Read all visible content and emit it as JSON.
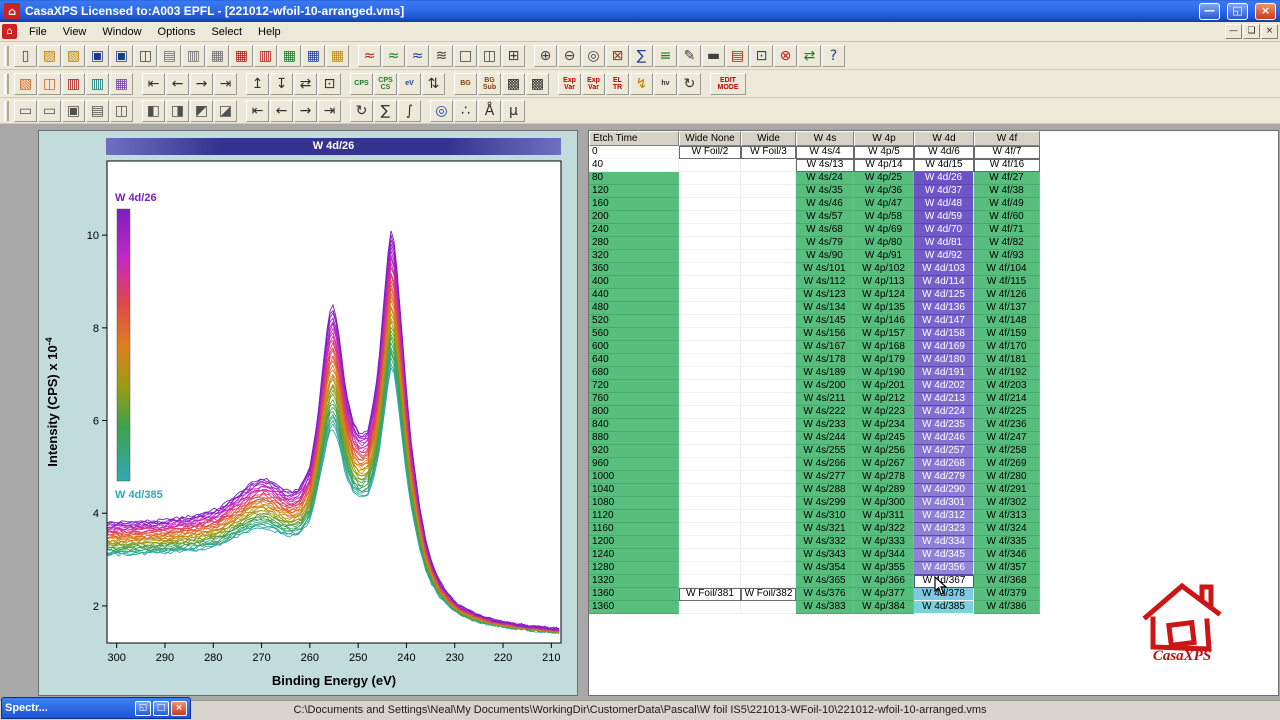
{
  "title_bar": {
    "title": "CasaXPS Licensed to:A003 EPFL - [221012-wfoil-10-arranged.vms]",
    "minimize": "—",
    "restore": "◱",
    "close": "×"
  },
  "menu": {
    "items": [
      "File",
      "View",
      "Window",
      "Options",
      "Select",
      "Help"
    ]
  },
  "toolbars": {
    "row1": [
      {
        "name": "new-file",
        "g": "▯",
        "c": "#404040"
      },
      {
        "name": "open-folder",
        "g": "▨",
        "c": "#C08A00"
      },
      {
        "name": "convert-folder",
        "g": "▧",
        "c": "#C08A00"
      },
      {
        "name": "save",
        "g": "▣",
        "c": "#163E8C"
      },
      {
        "name": "save-as",
        "g": "▣",
        "c": "#163E8C"
      },
      {
        "name": "copy-page",
        "g": "◫",
        "c": "#404040"
      },
      {
        "name": "page-single",
        "g": "▤",
        "c": "#707070"
      },
      {
        "name": "page-double",
        "g": "▥",
        "c": "#707070"
      },
      {
        "name": "page-grid",
        "g": "▦",
        "c": "#707070"
      },
      {
        "name": "block-red",
        "g": "▦",
        "c": "#B02020"
      },
      {
        "name": "block-red-2",
        "g": "▥",
        "c": "#B02020"
      },
      {
        "name": "block-green",
        "g": "▦",
        "c": "#207830"
      },
      {
        "name": "block-blue",
        "g": "▦",
        "c": "#203FA0"
      },
      {
        "name": "block-yellow",
        "g": "▦",
        "c": "#B89010"
      },
      {
        "sep": true
      },
      {
        "name": "spectrum-red",
        "g": "≈",
        "c": "#B02020"
      },
      {
        "name": "spectrum-green",
        "g": "≈",
        "c": "#207830"
      },
      {
        "name": "spectrum-blue",
        "g": "≈",
        "c": "#203FA0"
      },
      {
        "name": "overlay-spectra",
        "g": "≋",
        "c": "#404040"
      },
      {
        "name": "tile-one",
        "g": "□",
        "c": "#404040"
      },
      {
        "name": "tile-two",
        "g": "◫",
        "c": "#404040"
      },
      {
        "name": "tile-four",
        "g": "⊞",
        "c": "#404040"
      },
      {
        "sep": true
      },
      {
        "name": "zoom-in",
        "g": "⊕",
        "c": "#404040"
      },
      {
        "name": "zoom-out",
        "g": "⊖",
        "c": "#404040"
      },
      {
        "name": "zoom-reset",
        "g": "◎",
        "c": "#404040"
      },
      {
        "name": "processing",
        "g": "⊠",
        "c": "#8B4020"
      },
      {
        "name": "quantify",
        "g": "∑",
        "c": "#203FA0"
      },
      {
        "name": "element-library",
        "g": "≡",
        "c": "#207830"
      },
      {
        "name": "annotate",
        "g": "✎",
        "c": "#404040"
      },
      {
        "name": "print",
        "g": "▬",
        "c": "#404040"
      },
      {
        "name": "report",
        "g": "▤",
        "c": "#B02020"
      },
      {
        "name": "calculator",
        "g": "⊡",
        "c": "#203FA0"
      },
      {
        "name": "delete-block",
        "g": "⊗",
        "c": "#B02020"
      },
      {
        "name": "link-blocks",
        "g": "⇄",
        "c": "#207830"
      },
      {
        "name": "help",
        "g": "?",
        "c": "#203FA0"
      }
    ],
    "row2": [
      {
        "name": "orange-block",
        "g": "▧",
        "c": "#D2691E"
      },
      {
        "name": "cascade-pages",
        "g": "◫",
        "c": "#D2691E"
      },
      {
        "name": "red-book",
        "g": "▥",
        "c": "#B02020"
      },
      {
        "name": "teal-book",
        "g": "▥",
        "c": "#107878"
      },
      {
        "name": "purple-block",
        "g": "▦",
        "c": "#7040A0"
      },
      {
        "sep": true
      },
      {
        "name": "nav-first",
        "g": "⇤",
        "c": "#303030"
      },
      {
        "name": "nav-prev",
        "g": "←",
        "c": "#303030"
      },
      {
        "name": "nav-next",
        "g": "→",
        "c": "#303030"
      },
      {
        "name": "nav-last",
        "g": "⇥",
        "c": "#303030"
      },
      {
        "sep": true
      },
      {
        "name": "move-up",
        "g": "↥",
        "c": "#303030"
      },
      {
        "name": "move-down",
        "g": "↧",
        "c": "#303030"
      },
      {
        "name": "swap-blocks",
        "g": "⇄",
        "c": "#303030"
      },
      {
        "name": "zoom-region",
        "g": "⊡",
        "c": "#303030"
      },
      {
        "sep": true
      },
      {
        "name": "cps-scale",
        "txt": [
          "CPS"
        ],
        "c": "#207830"
      },
      {
        "name": "cps-cs-scale",
        "txt": [
          "CPS",
          "CS"
        ],
        "c": "#207830"
      },
      {
        "name": "ev-scale",
        "txt": [
          "eV"
        ],
        "c": "#203FA0"
      },
      {
        "name": "step-scale",
        "g": "⇅",
        "c": "#303030"
      },
      {
        "sep": true
      },
      {
        "name": "background",
        "txt": [
          "BG"
        ],
        "c": "#804010"
      },
      {
        "name": "background-subtract",
        "txt": [
          "BG",
          "Sub"
        ],
        "c": "#804010"
      },
      {
        "name": "component-fit",
        "g": "▩",
        "c": "#303030"
      },
      {
        "name": "component-fit-2",
        "g": "▩",
        "c": "#303030"
      },
      {
        "sep": true
      },
      {
        "name": "exp-var",
        "txt": [
          "Exp",
          "Var"
        ],
        "c": "#C00000"
      },
      {
        "name": "exp-var-2",
        "txt": [
          "Exp",
          "Var"
        ],
        "c": "#C00000"
      },
      {
        "name": "el-tr",
        "txt": [
          "EL",
          "TR"
        ],
        "c": "#C00000"
      },
      {
        "name": "lightning",
        "g": "↯",
        "c": "#C08000"
      },
      {
        "name": "hv-label",
        "txt": [
          "hv"
        ],
        "c": "#303030"
      },
      {
        "name": "refresh",
        "g": "↻",
        "c": "#303030"
      },
      {
        "sep": true
      },
      {
        "name": "edit-mode",
        "txt": [
          "EDIT",
          "MODE"
        ],
        "c": "#C00000",
        "wide": true
      }
    ],
    "row3": [
      {
        "name": "view-1",
        "g": "▭",
        "c": "#505050"
      },
      {
        "name": "view-2",
        "g": "▭",
        "c": "#505050"
      },
      {
        "name": "view-3",
        "g": "▣",
        "c": "#505050"
      },
      {
        "name": "view-4",
        "g": "▤",
        "c": "#505050"
      },
      {
        "name": "view-5",
        "g": "◫",
        "c": "#505050"
      },
      {
        "sep": true
      },
      {
        "name": "split-left",
        "g": "◧",
        "c": "#505050"
      },
      {
        "name": "split-right",
        "g": "◨",
        "c": "#505050"
      },
      {
        "name": "split-top",
        "g": "◩",
        "c": "#505050"
      },
      {
        "name": "split-bottom",
        "g": "◪",
        "c": "#505050"
      },
      {
        "sep": true
      },
      {
        "name": "page-first",
        "g": "⇤",
        "c": "#303030"
      },
      {
        "name": "page-prev",
        "g": "←",
        "c": "#303030"
      },
      {
        "name": "page-next",
        "g": "→",
        "c": "#303030"
      },
      {
        "name": "page-last",
        "g": "⇥",
        "c": "#303030"
      },
      {
        "sep": true
      },
      {
        "name": "rotate-view",
        "g": "↻",
        "c": "#303030"
      },
      {
        "name": "sum-spectra",
        "g": "∑",
        "c": "#303030"
      },
      {
        "name": "integrate",
        "g": "∫",
        "c": "#303030"
      },
      {
        "sep": true
      },
      {
        "name": "find",
        "g": "◎",
        "c": "#203FA0"
      },
      {
        "name": "markers",
        "g": "∴",
        "c": "#303030"
      },
      {
        "name": "angstrom",
        "g": "Å",
        "c": "#303030"
      },
      {
        "name": "micro",
        "g": "µ",
        "c": "#303030"
      }
    ]
  },
  "chart": {
    "header": "W 4d/26"
  },
  "chart_data": {
    "type": "line",
    "title": "W 4d/26",
    "xlabel": "Binding Energy (eV)",
    "ylabel_main": "Intensity (CPS) x 10",
    "ylabel_sup": "-4",
    "x_axis_reversed": true,
    "x_range": [
      302,
      208
    ],
    "y_range": [
      1.2,
      11.6
    ],
    "x_ticks": [
      300,
      290,
      280,
      270,
      260,
      250,
      240,
      230,
      220,
      210
    ],
    "y_ticks": [
      2,
      4,
      6,
      8,
      10
    ],
    "n_curves": 34,
    "first_label": "W 4d/26",
    "last_label": "W 4d/385",
    "x": [
      302,
      296,
      290,
      284,
      279,
      275,
      272,
      270,
      268,
      266,
      264,
      262,
      260,
      258.5,
      257.5,
      256.5,
      255.8,
      255,
      254,
      252.5,
      251,
      249.5,
      248,
      246.5,
      245.5,
      244.5,
      243.8,
      243.2,
      242.6,
      242,
      241.2,
      240.2,
      239,
      237.5,
      236,
      234.5,
      233,
      231,
      229,
      226,
      222,
      218,
      214,
      210,
      208
    ],
    "envelope_top": [
      3.8,
      3.82,
      3.85,
      3.95,
      4.1,
      4.4,
      4.65,
      4.75,
      4.7,
      4.55,
      4.45,
      4.55,
      5.0,
      5.95,
      6.95,
      7.95,
      8.35,
      8.5,
      7.9,
      6.6,
      5.95,
      5.7,
      5.8,
      6.55,
      7.5,
      8.8,
      9.6,
      10.1,
      9.9,
      9.3,
      8.3,
      6.9,
      5.5,
      4.3,
      3.4,
      2.85,
      2.5,
      2.2,
      2.0,
      1.85,
      1.7,
      1.62,
      1.56,
      1.52,
      1.5
    ],
    "envelope_bottom": [
      3.1,
      3.12,
      3.15,
      3.2,
      3.3,
      3.5,
      3.65,
      3.7,
      3.65,
      3.55,
      3.5,
      3.55,
      3.85,
      4.45,
      5.0,
      5.5,
      5.75,
      5.85,
      5.5,
      4.8,
      4.45,
      4.3,
      4.4,
      4.85,
      5.4,
      6.2,
      6.8,
      7.15,
      7.0,
      6.6,
      5.9,
      5.0,
      4.1,
      3.35,
      2.75,
      2.42,
      2.18,
      1.98,
      1.82,
      1.68,
      1.58,
      1.52,
      1.47,
      1.44,
      1.42
    ],
    "colormap": [
      [
        0,
        "#7A1FC0"
      ],
      [
        0.18,
        "#C428C4"
      ],
      [
        0.35,
        "#E0484A"
      ],
      [
        0.5,
        "#DE7F1E"
      ],
      [
        0.65,
        "#9C9C14"
      ],
      [
        0.8,
        "#3FA04B"
      ],
      [
        1,
        "#2FAAB4"
      ]
    ]
  },
  "table": {
    "headers": [
      "Etch Time",
      "Wide None",
      "Wide",
      "W 4s",
      "W 4p",
      "W 4d",
      "W 4f"
    ],
    "rows": [
      [
        "0",
        "W Foil/2",
        "W Foil/3",
        "W 4s/4",
        "W 4p/5",
        "W 4d/6",
        "W 4f/7"
      ],
      [
        "40",
        "",
        "",
        "W 4s/13",
        "W 4p/14",
        "W 4d/15",
        "W 4f/16"
      ],
      [
        "80",
        "",
        "",
        "W 4s/24",
        "W 4p/25",
        "W 4d/26",
        "W 4f/27"
      ],
      [
        "120",
        "",
        "",
        "W 4s/35",
        "W 4p/36",
        "W 4d/37",
        "W 4f/38"
      ],
      [
        "160",
        "",
        "",
        "W 4s/46",
        "W 4p/47",
        "W 4d/48",
        "W 4f/49"
      ],
      [
        "200",
        "",
        "",
        "W 4s/57",
        "W 4p/58",
        "W 4d/59",
        "W 4f/60"
      ],
      [
        "240",
        "",
        "",
        "W 4s/68",
        "W 4p/69",
        "W 4d/70",
        "W 4f/71"
      ],
      [
        "280",
        "",
        "",
        "W 4s/79",
        "W 4p/80",
        "W 4d/81",
        "W 4f/82"
      ],
      [
        "320",
        "",
        "",
        "W 4s/90",
        "W 4p/91",
        "W 4d/92",
        "W 4f/93"
      ],
      [
        "360",
        "",
        "",
        "W 4s/101",
        "W 4p/102",
        "W 4d/103",
        "W 4f/104"
      ],
      [
        "400",
        "",
        "",
        "W 4s/112",
        "W 4p/113",
        "W 4d/114",
        "W 4f/115"
      ],
      [
        "440",
        "",
        "",
        "W 4s/123",
        "W 4p/124",
        "W 4d/125",
        "W 4f/126"
      ],
      [
        "480",
        "",
        "",
        "W 4s/134",
        "W 4p/135",
        "W 4d/136",
        "W 4f/137"
      ],
      [
        "520",
        "",
        "",
        "W 4s/145",
        "W 4p/146",
        "W 4d/147",
        "W 4f/148"
      ],
      [
        "560",
        "",
        "",
        "W 4s/156",
        "W 4p/157",
        "W 4d/158",
        "W 4f/159"
      ],
      [
        "600",
        "",
        "",
        "W 4s/167",
        "W 4p/168",
        "W 4d/169",
        "W 4f/170"
      ],
      [
        "640",
        "",
        "",
        "W 4s/178",
        "W 4p/179",
        "W 4d/180",
        "W 4f/181"
      ],
      [
        "680",
        "",
        "",
        "W 4s/189",
        "W 4p/190",
        "W 4d/191",
        "W 4f/192"
      ],
      [
        "720",
        "",
        "",
        "W 4s/200",
        "W 4p/201",
        "W 4d/202",
        "W 4f/203"
      ],
      [
        "760",
        "",
        "",
        "W 4s/211",
        "W 4p/212",
        "W 4d/213",
        "W 4f/214"
      ],
      [
        "800",
        "",
        "",
        "W 4s/222",
        "W 4p/223",
        "W 4d/224",
        "W 4f/225"
      ],
      [
        "840",
        "",
        "",
        "W 4s/233",
        "W 4p/234",
        "W 4d/235",
        "W 4f/236"
      ],
      [
        "880",
        "",
        "",
        "W 4s/244",
        "W 4p/245",
        "W 4d/246",
        "W 4f/247"
      ],
      [
        "920",
        "",
        "",
        "W 4s/255",
        "W 4p/256",
        "W 4d/257",
        "W 4f/258"
      ],
      [
        "960",
        "",
        "",
        "W 4s/266",
        "W 4p/267",
        "W 4d/268",
        "W 4f/269"
      ],
      [
        "1000",
        "",
        "",
        "W 4s/277",
        "W 4p/278",
        "W 4d/279",
        "W 4f/280"
      ],
      [
        "1040",
        "",
        "",
        "W 4s/288",
        "W 4p/289",
        "W 4d/290",
        "W 4f/291"
      ],
      [
        "1080",
        "",
        "",
        "W 4s/299",
        "W 4p/300",
        "W 4d/301",
        "W 4f/302"
      ],
      [
        "1120",
        "",
        "",
        "W 4s/310",
        "W 4p/311",
        "W 4d/312",
        "W 4f/313"
      ],
      [
        "1160",
        "",
        "",
        "W 4s/321",
        "W 4p/322",
        "W 4d/323",
        "W 4f/324"
      ],
      [
        "1200",
        "",
        "",
        "W 4s/332",
        "W 4p/333",
        "W 4d/334",
        "W 4f/335"
      ],
      [
        "1240",
        "",
        "",
        "W 4s/343",
        "W 4p/344",
        "W 4d/345",
        "W 4f/346"
      ],
      [
        "1280",
        "",
        "",
        "W 4s/354",
        "W 4p/355",
        "W 4d/356",
        "W 4f/357"
      ],
      [
        "1320",
        "",
        "",
        "W 4s/365",
        "W 4p/366",
        "W 4d/367",
        "W 4f/368"
      ],
      [
        "1360",
        "W Foil/381",
        "W Foil/382",
        "W 4s/376",
        "W 4p/377",
        "W 4d/378",
        "W 4f/379"
      ],
      [
        "1360",
        "",
        "",
        "W 4s/383",
        "W 4p/384",
        "W 4d/385",
        "W 4f/386"
      ]
    ]
  },
  "colors": {
    "row_green": "#57BE7E",
    "w4d_purple_start": "#6C52C6",
    "w4d_purple_end": "#9184D8",
    "w4d_row_378": "#7FC9E0",
    "w4d_row_385": "#7CD2DC"
  },
  "logo": {
    "text": "CasaXPS"
  },
  "status": {
    "path": "C:\\Documents and Settings\\Neal\\My Documents\\WorkingDir\\CustomerData\\Pascal\\W foil IS5\\221013-WFoil-10\\221012-wfoil-10-arranged.vms"
  },
  "mini_window": {
    "title": "Spectr...",
    "restore": "◱",
    "maximize": "□",
    "close": "×"
  }
}
